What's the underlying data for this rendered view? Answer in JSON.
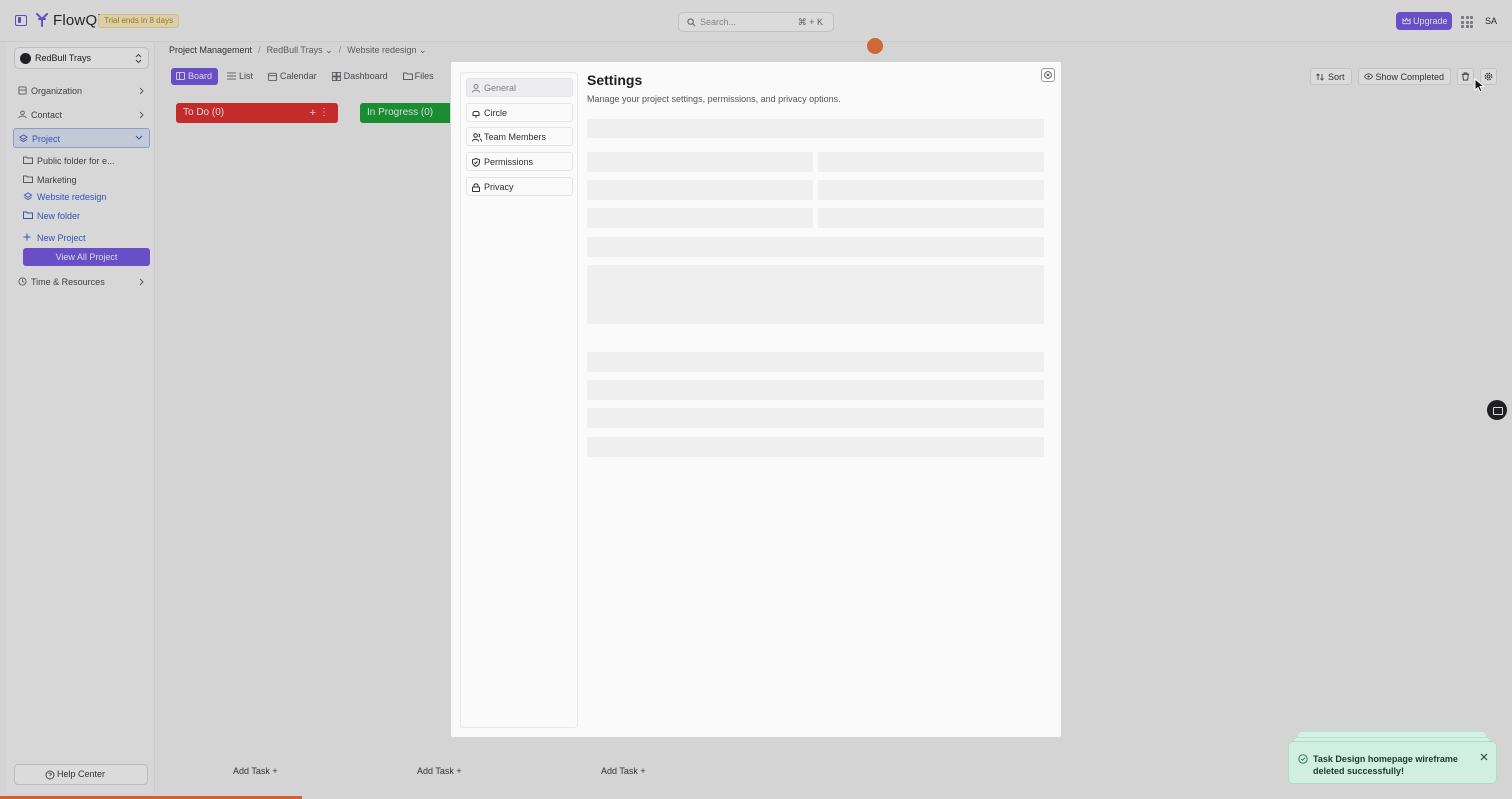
{
  "app": {
    "name": "FlowQi",
    "trial_badge": "Trial ends in 8 days",
    "search_placeholder": "Search...",
    "search_shortcut": "⌘ + K",
    "upgrade_label": "Upgrade",
    "user_initials": "SA"
  },
  "sidebar": {
    "workspace": "RedBull Trays",
    "items": [
      {
        "label": "Organization",
        "icon": "building-icon"
      },
      {
        "label": "Contact",
        "icon": "contact-icon"
      },
      {
        "label": "Project",
        "icon": "project-icon"
      },
      {
        "label": "Time & Resources",
        "icon": "clock-icon"
      }
    ],
    "project_items": [
      {
        "label": "Public folder for e...",
        "icon": "folder-icon"
      },
      {
        "label": "Marketing",
        "icon": "folder-icon"
      },
      {
        "label": "Website redesign",
        "icon": "layers-icon"
      },
      {
        "label": "New folder",
        "icon": "folder-icon"
      },
      {
        "label": "New Project",
        "icon": "plus-icon"
      }
    ],
    "view_all_label": "View All Project",
    "help_label": "Help Center"
  },
  "breadcrumb": {
    "root": "Project Management",
    "workspace": "RedBull Trays",
    "project": "Website redesign"
  },
  "views": {
    "tabs": [
      "Board",
      "List",
      "Calendar",
      "Dashboard",
      "Files"
    ],
    "active": "Board"
  },
  "toolbar": {
    "sort_label": "Sort",
    "show_completed_label": "Show Completed"
  },
  "board": {
    "columns": [
      {
        "title": "To Do (0)",
        "color": "#e53434"
      },
      {
        "title": "In Progress (0)",
        "color": "#1fa33a"
      }
    ],
    "add_task_label": "Add Task +"
  },
  "modal": {
    "title": "Settings",
    "subtitle": "Manage your project settings, permissions, and privacy options.",
    "nav": [
      {
        "label": "General",
        "icon": "user-icon",
        "active": true
      },
      {
        "label": "Circle",
        "icon": "bell-icon",
        "active": false
      },
      {
        "label": "Team Members",
        "icon": "users-icon",
        "active": false
      },
      {
        "label": "Permissions",
        "icon": "shield-icon",
        "active": false
      },
      {
        "label": "Privacy",
        "icon": "lock-icon",
        "active": false
      }
    ]
  },
  "toast": {
    "message": "Task Design homepage wireframe deleted successfully!"
  },
  "colors": {
    "accent": "#7b5de8",
    "link_blue": "#3b63d6",
    "todo": "#e53434",
    "in_progress": "#1fa33a",
    "toast_bg": "#d1efe1",
    "progress": "#f0733a"
  }
}
